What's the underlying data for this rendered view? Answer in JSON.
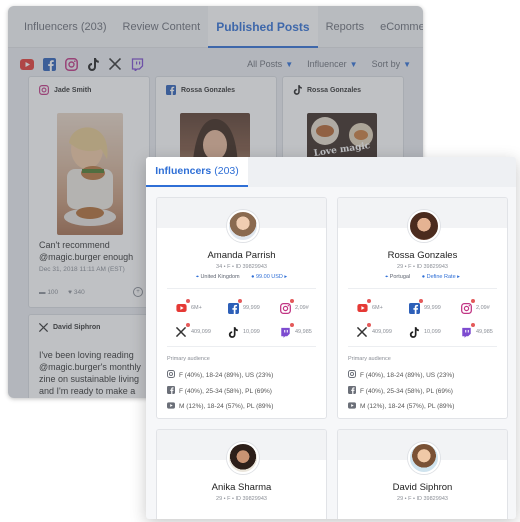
{
  "bg": {
    "tabs": [
      {
        "label": "Influencers (203)",
        "active": false
      },
      {
        "label": "Review Content",
        "active": false
      },
      {
        "label": "Published Posts",
        "active": true
      },
      {
        "label": "Reports",
        "active": false
      },
      {
        "label": "eCommerce",
        "active": false
      }
    ],
    "network_icons": [
      "youtube-icon",
      "facebook-icon",
      "instagram-icon",
      "tiktok-icon",
      "x-icon",
      "twitch-icon"
    ],
    "filters": [
      {
        "label": "All Posts"
      },
      {
        "label": "Influencer"
      },
      {
        "label": "Sort by"
      }
    ],
    "posts": [
      {
        "network": "instagram-icon",
        "author": "Jade Smith",
        "text": "Can't recommend @magic.burger enough",
        "date": "Dec 31, 2018 11:11 AM (EST)",
        "comments": "100",
        "likes": "340"
      },
      {
        "network": "facebook-icon",
        "author": "Rossa Gonzales"
      },
      {
        "network": "tiktok-icon",
        "author": "Rossa Gonzales",
        "overlay_text": "Love magic"
      },
      {
        "network": "x-icon",
        "author": "David Siphron",
        "text": "I've been loving reading @magic.burger's monthly zine on sustainable living and I'm ready to make a change. Follow my"
      }
    ]
  },
  "panel": {
    "tab_label": "Influencers",
    "tab_count": "(203)",
    "primary_audience_label": "Primary audience",
    "influencers": [
      {
        "name": "Amanda Parrish",
        "meta": "34  •  F  •  ID 39829943",
        "location": "United Kingdom",
        "rate": "99.00 USD",
        "stats": {
          "youtube": "6M+",
          "facebook": "99,999",
          "instagram": "2,09#",
          "x": "409,099",
          "tiktok": "10,099",
          "twitch": "49,985"
        },
        "audience": [
          "F (40%), 18-24 (89%), US (23%)",
          "F (40%), 25-34 (58%), PL (69%)",
          "M (12%), 18-24 (57%), PL (89%)"
        ]
      },
      {
        "name": "Rossa Gonzales",
        "meta": "29  •  F  •  ID 39829943",
        "location": "Portugal",
        "rate": "Define Rate",
        "stats": {
          "youtube": "6M+",
          "facebook": "99,999",
          "instagram": "2,09#",
          "x": "409,099",
          "tiktok": "10,099",
          "twitch": "49,985"
        },
        "audience": [
          "F (40%), 18-24 (89%), US (23%)",
          "F (40%), 25-34 (58%), PL (69%)",
          "M (12%), 18-24 (57%), PL (89%)"
        ]
      },
      {
        "name": "Anika Sharma",
        "meta": "29  •  F  •  ID 39829943"
      },
      {
        "name": "David Siphron",
        "meta": "29  •  F  •  ID 39829943"
      }
    ]
  }
}
